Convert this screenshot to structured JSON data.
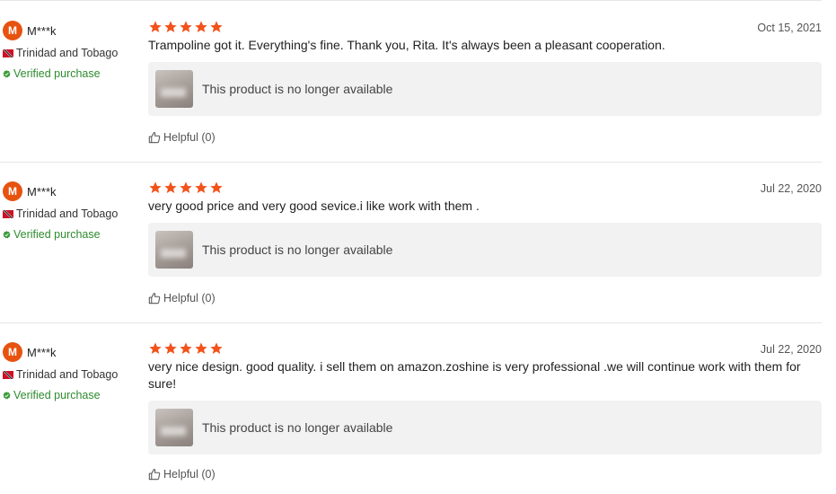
{
  "colors": {
    "accent": "#e8520f",
    "star": "#f2521b",
    "verified": "#2e8b2e",
    "card_bg": "#f2f2f2"
  },
  "reviews": [
    {
      "avatar_letter": "M",
      "username": "M***k",
      "country": "Trinidad and Tobago",
      "verified": "Verified purchase",
      "rating": 5,
      "date": "Oct 15, 2021",
      "text": "Trampoline got it. Everything's fine. Thank you, Rita. It's always been a pleasant cooperation.",
      "product_status": "This product is no longer available",
      "helpful": "Helpful (0)"
    },
    {
      "avatar_letter": "M",
      "username": "M***k",
      "country": "Trinidad and Tobago",
      "verified": "Verified purchase",
      "rating": 5,
      "date": "Jul 22, 2020",
      "text": "very good price and very good sevice.i like work with them .",
      "product_status": "This product is no longer available",
      "helpful": "Helpful (0)"
    },
    {
      "avatar_letter": "M",
      "username": "M***k",
      "country": "Trinidad and Tobago",
      "verified": "Verified purchase",
      "rating": 5,
      "date": "Jul 22, 2020",
      "text": "very nice design. good quality. i sell them on amazon.zoshine is very professional .we will continue work with them for sure!",
      "product_status": "This product is no longer available",
      "helpful": "Helpful (0)"
    }
  ]
}
